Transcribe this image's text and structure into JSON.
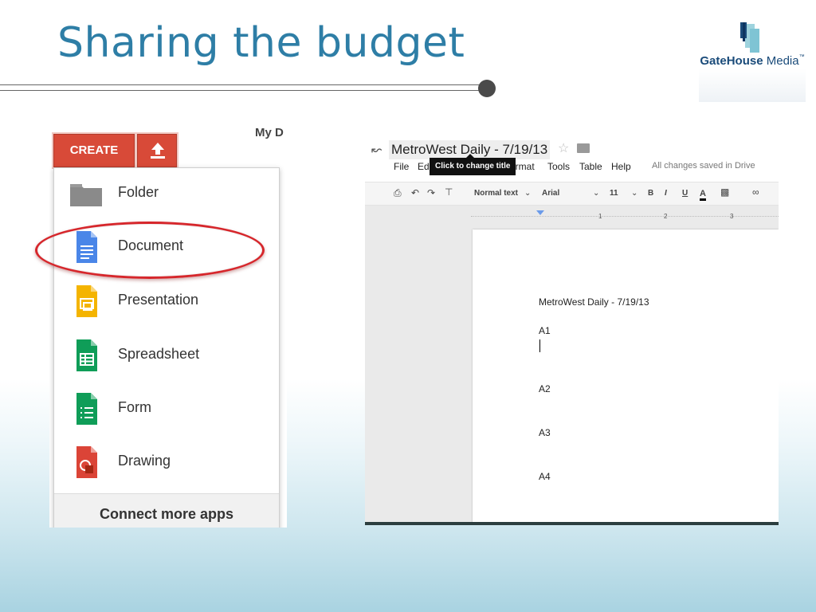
{
  "slide": {
    "title": "Sharing the budget",
    "logo": {
      "brand_bold": "GateHouse",
      "brand_light": "Media",
      "trademark": "™"
    }
  },
  "drive": {
    "my_drive_label": "My D",
    "create_label": "CREATE",
    "menu_items": [
      {
        "label": "Folder",
        "icon": "folder-icon"
      },
      {
        "label": "Document",
        "icon": "document-icon"
      },
      {
        "label": "Presentation",
        "icon": "presentation-icon"
      },
      {
        "label": "Spreadsheet",
        "icon": "spreadsheet-icon"
      },
      {
        "label": "Form",
        "icon": "form-icon"
      },
      {
        "label": "Drawing",
        "icon": "drawing-icon"
      }
    ],
    "connect_label": "Connect more apps",
    "highlighted_item": "Document",
    "colors": {
      "create_red": "#d84a38",
      "highlight_ring": "#d6262b"
    }
  },
  "docs": {
    "title": "MetroWest Daily - 7/19/13",
    "menu": {
      "file": "File",
      "edit": "Ed",
      "format": "ormat",
      "tools": "Tools",
      "table": "Table",
      "help": "Help"
    },
    "tooltip": "Click to change title",
    "save_status": "All changes saved in Drive",
    "toolbar": {
      "style": "Normal text",
      "font": "Arial",
      "size": "11",
      "bold": "B",
      "italic": "I",
      "underline": "U",
      "text_color": "A"
    },
    "ruler_marks": [
      "1",
      "2",
      "3"
    ],
    "page_lines": [
      "MetroWest Daily - 7/19/13",
      "A1",
      "A2",
      "A3",
      "A4"
    ]
  }
}
